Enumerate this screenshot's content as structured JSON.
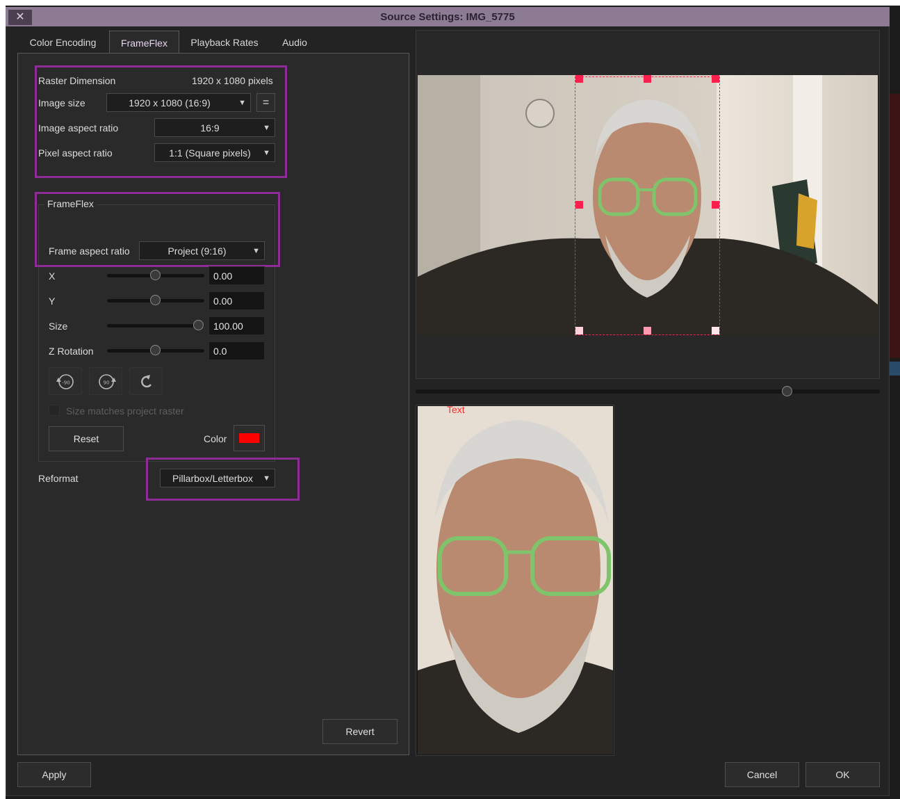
{
  "window": {
    "title": "Source Settings: IMG_5775",
    "close_glyph": "✕"
  },
  "tabs": [
    {
      "label": "Color Encoding",
      "active": false
    },
    {
      "label": "FrameFlex",
      "active": true
    },
    {
      "label": "Playback Rates",
      "active": false
    },
    {
      "label": "Audio",
      "active": false
    }
  ],
  "raster": {
    "heading": "Raster Dimension",
    "dimension_value": "1920 x 1080 pixels",
    "image_size_label": "Image size",
    "image_size_value": "1920 x 1080 (16:9)",
    "link_glyph": "=",
    "image_aspect_label": "Image aspect ratio",
    "image_aspect_value": "16:9",
    "pixel_aspect_label": "Pixel aspect ratio",
    "pixel_aspect_value": "1:1 (Square pixels)"
  },
  "frameflex": {
    "group_label": "FrameFlex",
    "frame_aspect_label": "Frame aspect ratio",
    "frame_aspect_value": "Project (9:16)",
    "x_label": "X",
    "x_value": "0.00",
    "y_label": "Y",
    "y_value": "0.00",
    "size_label": "Size",
    "size_value": "100.00",
    "zrot_label": "Z Rotation",
    "zrot_value": "0.0",
    "size_matches_label": "Size matches project raster",
    "reset_label": "Reset",
    "color_label": "Color",
    "color_swatch": "#ff0000"
  },
  "reformat": {
    "label": "Reformat",
    "value": "Pillarbox/Letterbox"
  },
  "buttons": {
    "revert": "Revert",
    "apply": "Apply",
    "cancel": "Cancel",
    "ok": "OK"
  },
  "preview": {
    "overlay_text": "Text",
    "zoom_level": 0.8
  },
  "colors": {
    "highlight": "#8e2d96",
    "crop_box": "#ff1f4f",
    "accent_tab": "#e6d6f0"
  }
}
